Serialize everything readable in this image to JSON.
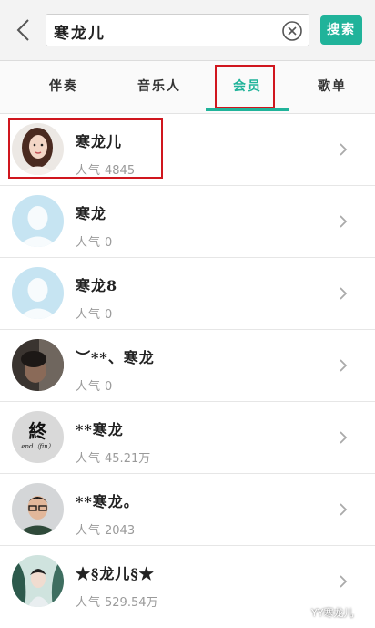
{
  "header": {
    "back_icon": "chevron-left-icon",
    "search_value": "寒龙儿",
    "clear_icon": "circle-x-icon",
    "search_button": "搜索"
  },
  "tabs": [
    {
      "label": "伴奏",
      "active": false
    },
    {
      "label": "音乐人",
      "active": false
    },
    {
      "label": "会员",
      "active": true
    },
    {
      "label": "歌单",
      "active": false
    }
  ],
  "popularity_label": "人气",
  "results": [
    {
      "name": "寒龙儿",
      "popularity": "4845",
      "avatar": "photo-woman"
    },
    {
      "name": "寒龙",
      "popularity": "0",
      "avatar": "default-user"
    },
    {
      "name": "寒龙8",
      "popularity": "0",
      "avatar": "default-user"
    },
    {
      "name": "︶**、寒龙",
      "popularity": "0",
      "avatar": "photo-dark"
    },
    {
      "name": "**寒龙",
      "popularity": "45.21万",
      "avatar": "text-end-fin"
    },
    {
      "name": "**寒龙。",
      "popularity": "2043",
      "avatar": "photo-man"
    },
    {
      "name": "★§龙儿§★",
      "popularity": "529.54万",
      "avatar": "photo-painting"
    }
  ],
  "avatar_text": {
    "top": "終",
    "bottom": "end（fin）"
  },
  "watermark": "YY寒龙儿",
  "colors": {
    "accent": "#20b39a",
    "highlight": "#d0161e"
  }
}
